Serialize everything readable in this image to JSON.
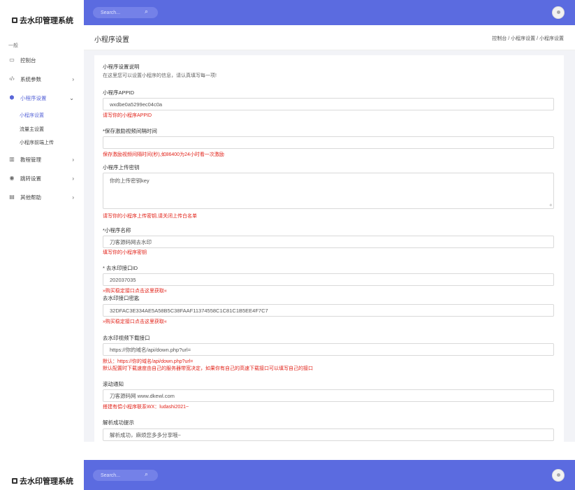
{
  "app": {
    "title": "去水印管理系统"
  },
  "topbar": {
    "search_placeholder": "Search..."
  },
  "sidebar": {
    "section": "一般",
    "items": [
      {
        "label": "控制台"
      },
      {
        "label": "系统参数"
      },
      {
        "label": "小程序设置"
      },
      {
        "label": "教程管理"
      },
      {
        "label": "跳转设置"
      },
      {
        "label": "其他帮助"
      }
    ],
    "subitems": [
      {
        "label": "小程序设置"
      },
      {
        "label": "流量主设置"
      },
      {
        "label": "小程序前端上传"
      }
    ]
  },
  "header": {
    "title": "小程序设置",
    "breadcrumb": "控制台 / 小程序设置 / 小程序设置"
  },
  "form": {
    "intro_title": "小程序设置说明",
    "intro_desc": "在这里您可以设置小程序的信息，请认真填写每一项!",
    "appid_label": "小程序APPID",
    "appid_value": "wxdbe0a5299ec04c0a",
    "appid_hint": "请写你的小程序APPID",
    "cache_label": "*保存激励视频间隔时间",
    "cache_value": "",
    "cache_hint": "保存激励视频间隔时间(秒),如86400为24小时看一次激励",
    "upload_label": "小程序上传密钥",
    "upload_value": "你的上传密钥key",
    "upload_hint": "请写你的小程序上传密钥,请关闭上传白名单",
    "name_label": "*小程序名称",
    "name_value": "刀客源码网去水印",
    "name_hint": "填写你的小程序密钥",
    "apiid_label": "* 去水印接口ID",
    "apiid_value": "202037035",
    "apiid_hint": "»购买稳定接口点击这里获取«",
    "apikey_label": "去水印接口密匙",
    "apikey_value": "32DFAC3E334AE5A58B5C38FAAF11374558C1C81C1B5EE4F7C7",
    "apikey_hint": "»购买稳定接口点击这里获取«",
    "download_label": "去水印视频下载接口",
    "download_value": "https://你的域名/api/down.php?url=",
    "download_hint1": "默认：https://你的域名/api/down.php?url=",
    "download_hint2": "默认配置时下载速度由自己的服务器带宽决定，如果你有自己的高速下载接口可以填写自己的接口",
    "notice_label": "滚动通知",
    "notice_value": "刀客源码网 www.dkewl.com",
    "notice_hint": "搭建有偿小程序联系WX：ludashi2021~",
    "success_label": "解析成功提示",
    "success_value": "解析成功，麻烦您多多分享哦~"
  },
  "colors": {
    "accent": "#5b6be0",
    "hint": "#e2231a",
    "content_bg": "#f2f3f7"
  },
  "icons": {
    "dashboard": "monitor-icon",
    "params": "code-icon",
    "miniprogram": "shield-icon",
    "tutorial": "book-icon",
    "redirect": "disc-icon",
    "help": "document-icon",
    "search": "search-icon",
    "logo": "logo-square-icon"
  }
}
